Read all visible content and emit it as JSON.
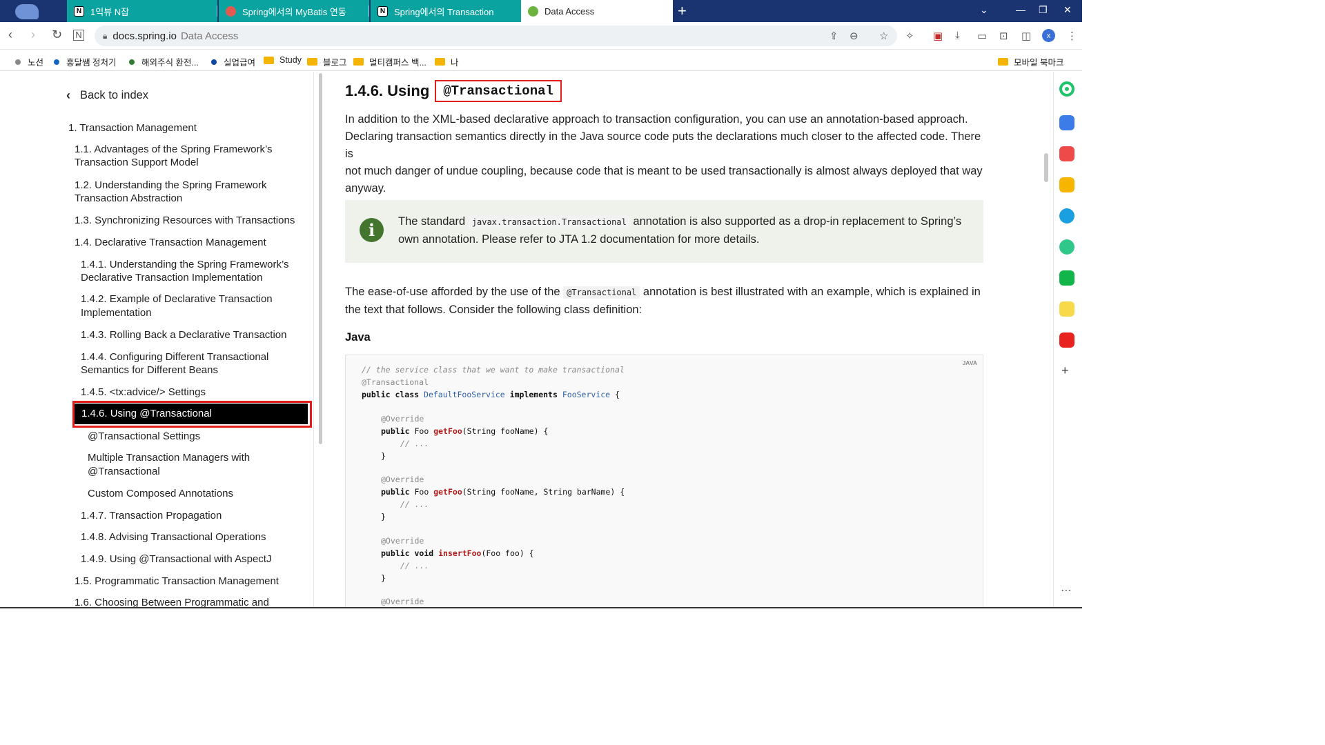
{
  "tabs": [
    {
      "label": "1억뷰 N잡",
      "icon": "notion-icon"
    },
    {
      "label": "Spring에서의 MyBatis 연동",
      "icon": "spring-icon"
    },
    {
      "label": "Spring에서의 Transaction",
      "icon": "notion-icon"
    },
    {
      "label": "Data Access",
      "icon": "spring-leaf-icon"
    }
  ],
  "address": {
    "host": "docs.spring.io",
    "title": "Data Access"
  },
  "profile_initial": "x",
  "bookmarks": [
    {
      "label": "노선",
      "color": "#888888"
    },
    {
      "label": "흥달쌤 정처기",
      "color": "#1565c0"
    },
    {
      "label": "해외주식 환전...",
      "color": "#2e7d32"
    },
    {
      "label": "실업급여",
      "color": "#0d47a1"
    },
    {
      "label": "Study",
      "folder": true
    },
    {
      "label": "블로그",
      "folder": true
    },
    {
      "label": "멀티캠퍼스 백...",
      "folder": true
    },
    {
      "label": "나",
      "folder": true
    },
    {
      "label": "모바일 북마크",
      "folder": true
    }
  ],
  "toc": {
    "back": "Back to index",
    "items": [
      "1. Transaction Management",
      "1.1. Advantages of the Spring Framework’s",
      "Transaction Support Model",
      "1.2. Understanding the Spring Framework",
      "Transaction Abstraction",
      "1.3. Synchronizing Resources with Transactions",
      "1.4. Declarative Transaction Management",
      "1.4.1. Understanding the Spring Framework’s",
      "Declarative Transaction Implementation",
      "1.4.2. Example of Declarative Transaction",
      "Implementation",
      "1.4.3. Rolling Back a Declarative Transaction",
      "1.4.4. Configuring Different Transactional",
      "Semantics for Different Beans",
      "1.4.5. <tx:advice/> Settings",
      "1.4.6. Using @Transactional",
      "@Transactional Settings",
      "Multiple Transaction Managers with",
      "@Transactional",
      "Custom Composed Annotations",
      "1.4.7. Transaction Propagation",
      "1.4.8. Advising Transactional Operations",
      "1.4.9. Using @Transactional with AspectJ",
      "1.5. Programmatic Transaction Management",
      "1.6. Choosing Between Programmatic and"
    ]
  },
  "main": {
    "heading_prefix": "1.4.6. Using",
    "heading_code": "@Transactional",
    "p1": [
      "In addition to the XML-based declarative approach to transaction configuration, you can use an annotation-based approach.",
      "Declaring transaction semantics directly in the Java source code puts the declarations much closer to the affected code. There is",
      "not much danger of undue coupling, because code that is meant to be used transactionally is almost always deployed that way",
      "anyway."
    ],
    "note_pre": "The standard",
    "note_code": "javax.transaction.Transactional",
    "note_post": "annotation is also supported as a drop-in replacement to Spring’s",
    "note_line2": "own annotation. Please refer to JTA 1.2 documentation for more details.",
    "p2_pre": "The ease-of-use afforded by the use of the",
    "p2_code": "@Transactional",
    "p2_post": "annotation is best illustrated with an example, which is explained in",
    "p2_line2": "the text that follows. Consider the following class definition:",
    "java_label": "Java",
    "code_lang": "JAVA",
    "code": {
      "c1": "// the service class that we want to make transactional",
      "c2": "@Transactional",
      "c3a": "public class",
      "c3b": "DefaultFooService",
      "c3c": "implements",
      "c3d": "FooService",
      "c3e": "{",
      "ov": "@Override",
      "pub": "public",
      "foo": "Foo",
      "void": "void",
      "m1": "getFoo",
      "m1args": "(String fooName) {",
      "m2args": "(String fooName, String barName) {",
      "m3": "insertFoo",
      "m3args": "(Foo foo) {",
      "dots": "// ...",
      "close": "}"
    }
  }
}
